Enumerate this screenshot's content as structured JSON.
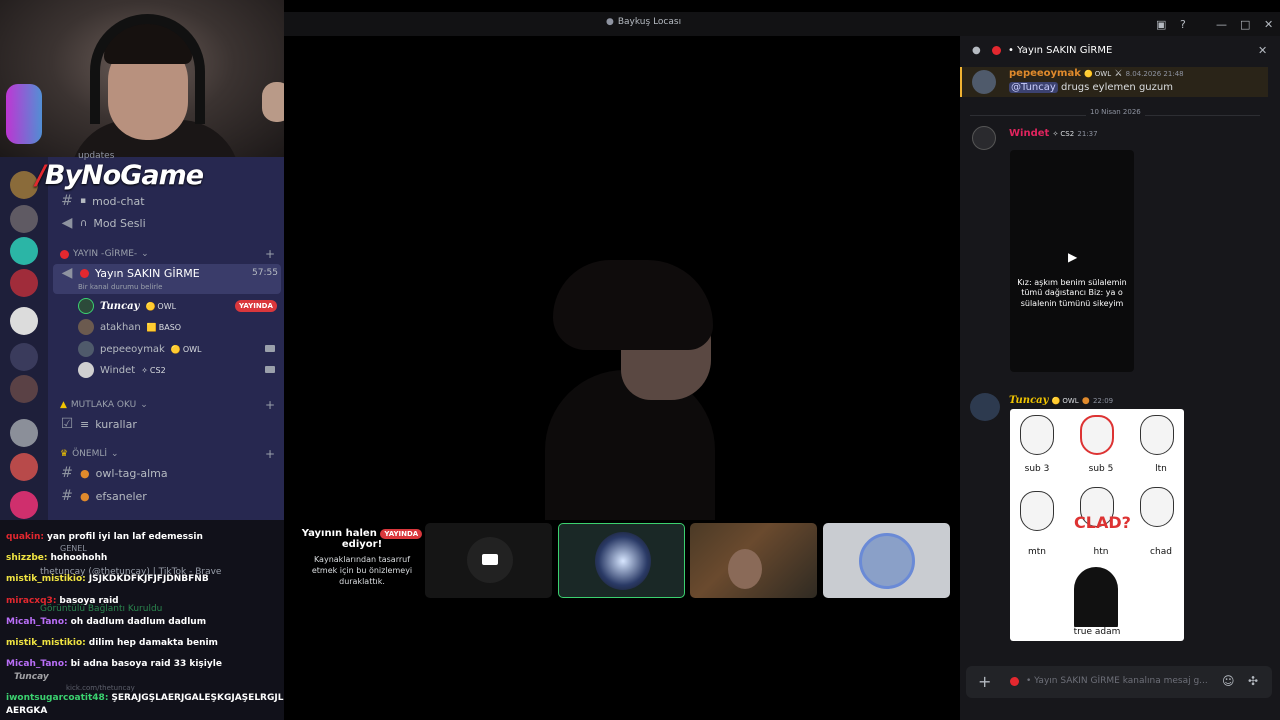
{
  "window": {
    "title": "Baykuş Locası"
  },
  "brand": {
    "name": "ByNoGame"
  },
  "sidebar": {
    "top_item": "updates",
    "channels": [
      {
        "label": "mod-chat"
      },
      {
        "label": "Mod Sesli"
      }
    ],
    "category_yayin": "YAYIN -GİRME-",
    "voice_channel": {
      "label": "Yayın SAKIN GİRME",
      "time": "57:55",
      "status": "Bir kanal durumu belirle"
    },
    "voice_members": [
      {
        "name": "Tuncay",
        "tag": "OWL",
        "badge": "YAYINDA"
      },
      {
        "name": "atakhan",
        "tag": "BASO"
      },
      {
        "name": "pepeeoymak",
        "tag": "OWL"
      },
      {
        "name": "Windet",
        "tag": "CS2"
      }
    ],
    "category_oku": "MUTLAKA OKU",
    "rules_channel": "kurallar",
    "category_onemli": "ÖNEMLİ",
    "onemli_channels": [
      {
        "label": "owl-tag-alma"
      },
      {
        "label": "efsaneler"
      }
    ],
    "category_genel": "GENEL"
  },
  "user_panel": {
    "name": "Tuncay",
    "sub": "kick.com/thetuncay",
    "notice": "Görüntülü Bağlantı Kuruldu",
    "activity": "thetuncay (@thetuncay) | TikTok - Brave"
  },
  "twitch_chat": [
    {
      "user": "quakin:",
      "text": "yan profil iyi lan laf edemessin",
      "color": "#e3282f"
    },
    {
      "user": "shizzbe:",
      "text": "hohoohohh",
      "color": "#f0e442"
    },
    {
      "user": "mistik_mistikio:",
      "text": "JSJKDKDFKJFJFJDNBFNB",
      "color": "#f0e442"
    },
    {
      "user": "miracxq3:",
      "text": "basoya raid",
      "color": "#e3282f"
    },
    {
      "user": "Micah_Tano:",
      "text": "oh dadlum dadlum dadlum",
      "color": "#b96ef7"
    },
    {
      "user": "mistik_mistikio:",
      "text": "dilim hep damakta benim",
      "color": "#f0e442"
    },
    {
      "user": "Micah_Tano:",
      "text": "bi adna basoya raid 33 kişiyle",
      "color": "#b96ef7"
    },
    {
      "user": "iwontsugarcoatit48:",
      "text": "ŞERAJGŞLAERJGALEŞKGJAŞELRGJL",
      "color": "#3bd16f"
    },
    {
      "user": "",
      "text": "AERGKA",
      "color": "#fff"
    }
  ],
  "stream": {
    "notice_title": "Yayının halen",
    "notice_title2": "ediyor!",
    "badge": "YAYINDA",
    "notice_body": "Kaynaklarından tasarruf etmek için bu önizlemeyi duraklattık."
  },
  "chat_panel": {
    "channel": "Yayın SAKIN GİRME",
    "messages": [
      {
        "user": "pepeeoymak",
        "tag": "OWL",
        "time": "8.04.2026 21:48",
        "mention": "@Tuncay",
        "text": "drugs eylemen guzum"
      },
      {
        "user": "Windet",
        "tag": "CS2",
        "time": "21:37"
      },
      {
        "user": "Tuncay",
        "tag": "OWL",
        "time": "22:09"
      }
    ],
    "date_divider": "10 Nisan 2026",
    "video_caption": "Kız: aşkım benim sülalemin tümü dağıstancı Biz: ya o sülalenin tümünü sikeyim",
    "meme_labels": [
      "sub 3",
      "sub 5",
      "ltn",
      "mtn",
      "htn",
      "chad",
      "true adam"
    ],
    "meme_overlay": "CLAD?",
    "composer_placeholder": "Yayın SAKIN GİRME kanalına mesaj g..."
  }
}
